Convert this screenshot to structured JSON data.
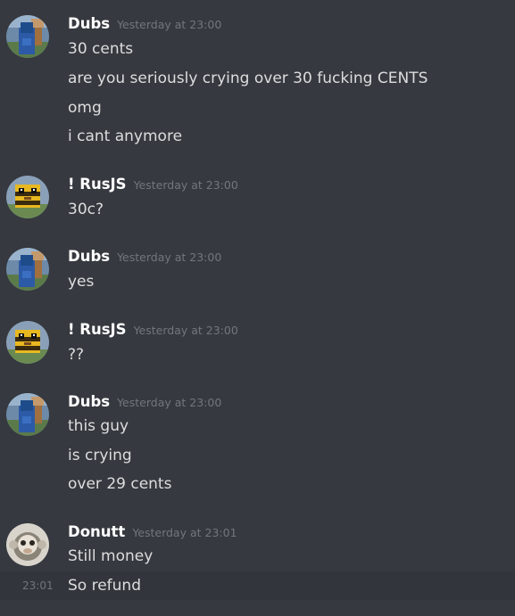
{
  "messages": [
    {
      "author": "Dubs",
      "timestamp": "Yesterday at 23:00",
      "avatar_icon": "minecraft-blue-avatar",
      "lines": [
        "30 cents",
        "are you seriously crying over 30 fucking CENTS",
        "omg",
        "i cant anymore"
      ]
    },
    {
      "author": "! RusJS",
      "timestamp": "Yesterday at 23:00",
      "avatar_icon": "bee-avatar",
      "lines": [
        "30c?"
      ]
    },
    {
      "author": "Dubs",
      "timestamp": "Yesterday at 23:00",
      "avatar_icon": "minecraft-blue-avatar",
      "lines": [
        "yes"
      ]
    },
    {
      "author": "! RusJS",
      "timestamp": "Yesterday at 23:00",
      "avatar_icon": "bee-avatar",
      "lines": [
        "??"
      ]
    },
    {
      "author": "Dubs",
      "timestamp": "Yesterday at 23:00",
      "avatar_icon": "minecraft-blue-avatar",
      "lines": [
        "this guy",
        "is crying",
        "over 29 cents"
      ]
    },
    {
      "author": "Donutt",
      "timestamp": "Yesterday at 23:01",
      "avatar_icon": "monkey-avatar",
      "lines": [
        "Still money",
        "So refund"
      ],
      "hover_time": "23:01"
    }
  ],
  "colors": {
    "background": "#36393f",
    "hover_row": "#32353b",
    "author": "#ffffff",
    "text": "#dcddde",
    "muted": "#72767d"
  }
}
